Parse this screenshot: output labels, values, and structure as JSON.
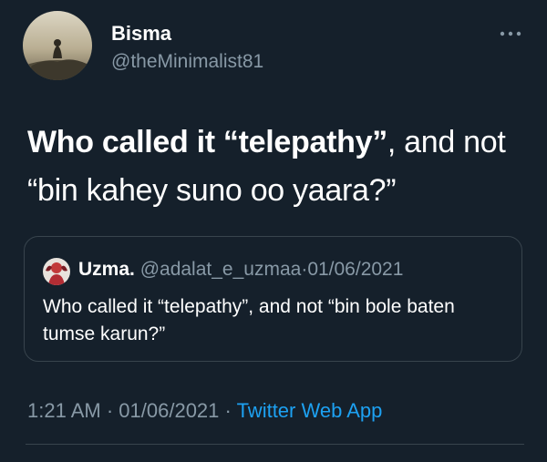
{
  "author": {
    "display_name": "Bisma",
    "handle": "@theMinimalist81"
  },
  "tweet": {
    "text_bold": "Who called it “telepathy”",
    "text_rest": ", and not “bin kahey suno oo yaara?”"
  },
  "quoted_tweet": {
    "display_name": "Uzma.",
    "handle": "@adalat_e_uzmaa",
    "separator": "·",
    "date": "01/06/2021",
    "text": "Who called it “telepathy”, and not “bin bole baten tumse karun?”"
  },
  "footer": {
    "time": "1:21 AM",
    "separator": "·",
    "date": "01/06/2021",
    "separator2": "·",
    "app": "Twitter Web App"
  },
  "colors": {
    "background": "#15202b",
    "secondary_text": "#8899a6",
    "accent": "#1da1f2",
    "border": "#38444d"
  },
  "icons": {
    "more": "more-horizontal-icon"
  }
}
